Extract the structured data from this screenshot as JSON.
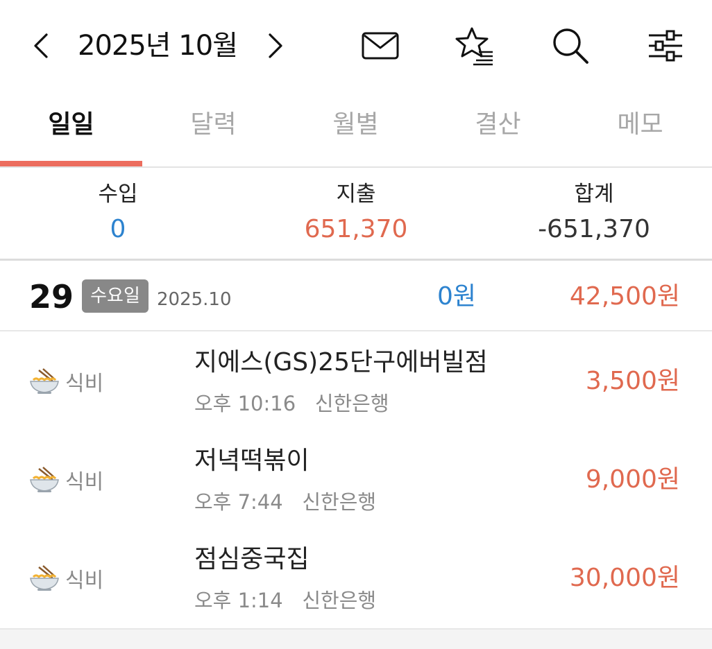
{
  "header": {
    "month_title": "2025년 10월",
    "icons": [
      "chevron-left-icon",
      "chevron-right-icon",
      "mail-icon",
      "star-list-icon",
      "search-icon",
      "filter-sliders-icon"
    ]
  },
  "tabs": [
    {
      "label": "일일",
      "active": true
    },
    {
      "label": "달력",
      "active": false
    },
    {
      "label": "월별",
      "active": false
    },
    {
      "label": "결산",
      "active": false
    },
    {
      "label": "메모",
      "active": false
    }
  ],
  "summary": {
    "income_label": "수입",
    "income_value": "0",
    "expense_label": "지출",
    "expense_value": "651,370",
    "total_label": "합계",
    "total_value": "-651,370"
  },
  "day": {
    "number": "29",
    "weekday": "수요일",
    "year_month": "2025.10",
    "income": "0원",
    "expense": "42,500원"
  },
  "entries": [
    {
      "category": "식비",
      "category_icon": "noodle-bowl-icon",
      "title": "지에스(GS)25단구에버빌점",
      "time": "오후 10:16",
      "account": "신한은행",
      "amount": "3,500원"
    },
    {
      "category": "식비",
      "category_icon": "noodle-bowl-icon",
      "title": "저녁떡볶이",
      "time": "오후 7:44",
      "account": "신한은행",
      "amount": "9,000원"
    },
    {
      "category": "식비",
      "category_icon": "noodle-bowl-icon",
      "title": "점심중국집",
      "time": "오후 1:14",
      "account": "신한은행",
      "amount": "30,000원"
    }
  ],
  "colors": {
    "accent": "#ec6d5e",
    "income": "#2d83cf",
    "expense": "#e0694f",
    "inactive_tab": "#a7a7a7"
  }
}
